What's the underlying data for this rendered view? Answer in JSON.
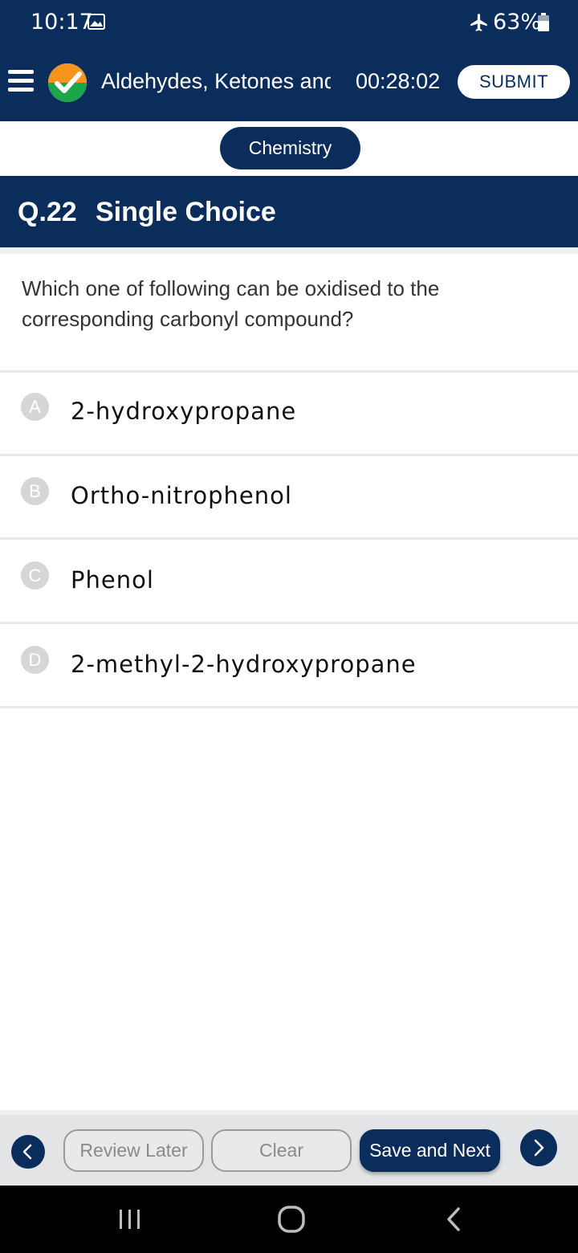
{
  "status_bar": {
    "time": "10:17",
    "battery": "63%",
    "icons": [
      "gallery-icon",
      "airplane-icon",
      "battery-icon"
    ]
  },
  "header": {
    "title": "Aldehydes, Ketones and",
    "timer": "00:28:02",
    "submit_label": "SUBMIT",
    "icons": [
      "menu-icon",
      "logo-checkmark-icon"
    ]
  },
  "subject": {
    "label": "Chemistry"
  },
  "question": {
    "number": "Q.22",
    "type": "Single Choice",
    "text": "Which one of following can be oxidised to the corresponding carbonyl compound?"
  },
  "options": [
    {
      "letter": "A",
      "text": "2-hydroxypropane"
    },
    {
      "letter": "B",
      "text": "Ortho-nitrophenol"
    },
    {
      "letter": "C",
      "text": "Phenol"
    },
    {
      "letter": "D",
      "text": "2-methyl-2-hydroxypropane"
    }
  ],
  "actions": {
    "review_label": "Review Later",
    "clear_label": "Clear",
    "save_next_label": "Save and Next"
  },
  "colors": {
    "primary": "#0b2d5b",
    "option_badge": "#d6d6d6",
    "logo_orange": "#f7941d",
    "logo_green": "#1aa64a"
  }
}
